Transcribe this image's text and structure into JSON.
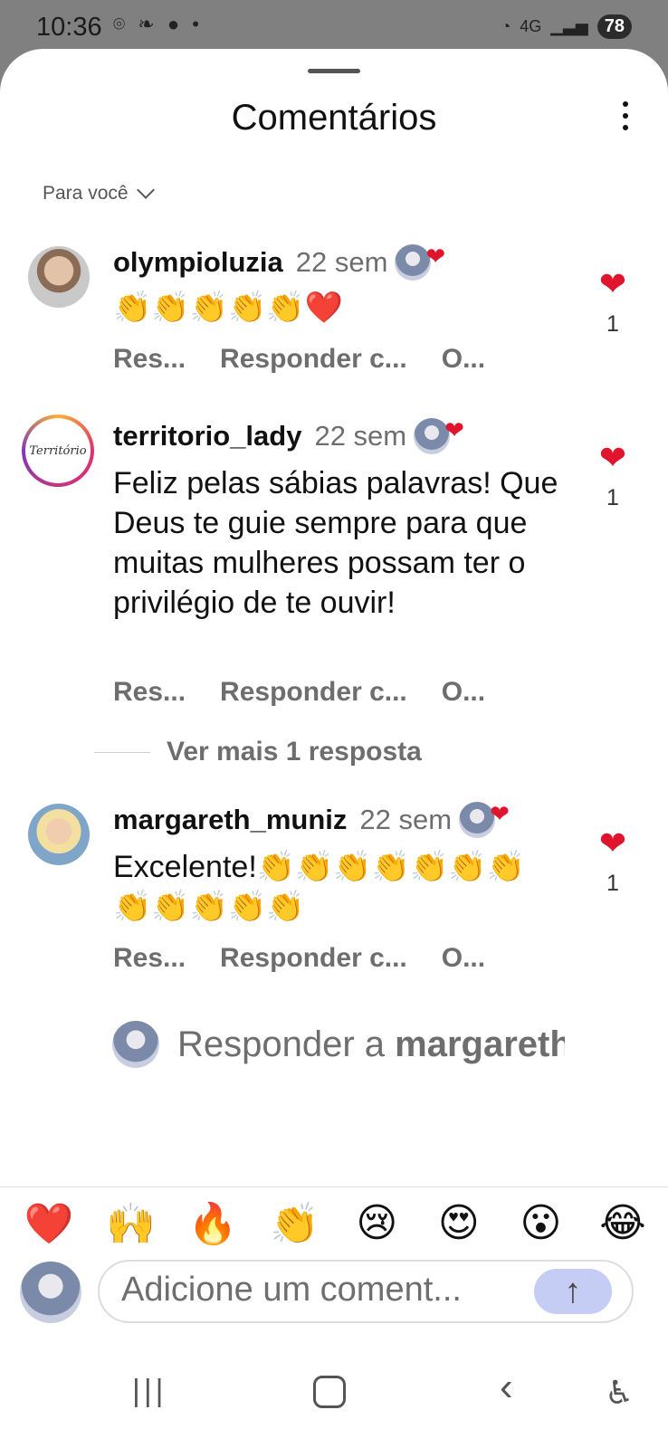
{
  "status": {
    "time": "10:36",
    "icons_left": "⌾ ❧ ● •",
    "network": "4G",
    "battery": "78"
  },
  "header": {
    "title": "Comentários",
    "filter_label": "Para você"
  },
  "comments": [
    {
      "username": "olympioluzia",
      "time": "22 sem",
      "text": "👏👏👏👏👏❤️",
      "likes": "1",
      "actions": [
        "Res...",
        "Responder c...",
        "O..."
      ]
    },
    {
      "username": "territorio_lady",
      "avatar_text": "Território",
      "time": "22 sem",
      "text": "Feliz pelas sábias palavras! Que Deus te guie sempre para que muitas mulheres possam ter o privilégio de te ouvir!",
      "likes": "1",
      "actions": [
        "Res...",
        "Responder c...",
        "O..."
      ]
    },
    {
      "username": "margareth_muniz",
      "time": "22 sem",
      "text": "Excelente!👏👏👏👏👏👏👏👏👏👏👏👏",
      "likes": "1",
      "actions": [
        "Res...",
        "Responder c...",
        "O..."
      ]
    }
  ],
  "view_more": "Ver mais 1 resposta",
  "reply": {
    "prefix": "Responder a ",
    "target": "margareth_muniz"
  },
  "emoji_bar": [
    "❤️",
    "🙌",
    "🔥",
    "👏",
    "😢",
    "😍",
    "😮",
    "😂"
  ],
  "composer": {
    "placeholder": "Adicione um coment...",
    "send_icon": "↑"
  },
  "navbar": {
    "recents": "|||",
    "back": "‹",
    "accessibility": "♿"
  },
  "colors": {
    "like_red": "#e0142c",
    "send_bg": "#c6cdf5",
    "muted_text": "#6e6e6e"
  }
}
